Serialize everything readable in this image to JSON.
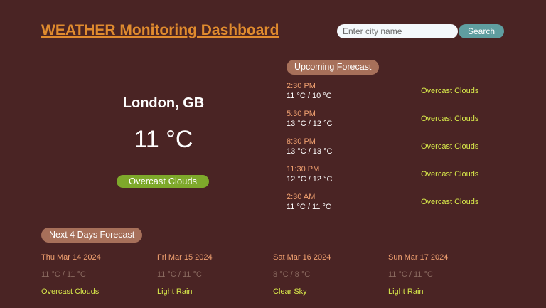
{
  "header": {
    "title": "WEATHER Monitoring Dashboard"
  },
  "search": {
    "placeholder": "Enter city name",
    "value": "",
    "button_label": "Search"
  },
  "current": {
    "location": "London, GB",
    "temperature": "11 °C",
    "condition": "Overcast Clouds"
  },
  "upcoming": {
    "heading": "Upcoming Forecast",
    "items": [
      {
        "time": "2:30 PM",
        "temp": "11 °C / 10 °C",
        "desc": "Overcast Clouds"
      },
      {
        "time": "5:30 PM",
        "temp": "13 °C / 12 °C",
        "desc": "Overcast Clouds"
      },
      {
        "time": "8:30 PM",
        "temp": "13 °C / 13 °C",
        "desc": "Overcast Clouds"
      },
      {
        "time": "11:30 PM",
        "temp": "12 °C / 12 °C",
        "desc": "Overcast Clouds"
      },
      {
        "time": "2:30 AM",
        "temp": "11 °C / 11 °C",
        "desc": "Overcast Clouds"
      }
    ]
  },
  "daily": {
    "heading": "Next 4 Days Forecast",
    "days": [
      {
        "date": "Thu Mar 14 2024",
        "temp": "11 °C / 11 °C",
        "desc": "Overcast Clouds"
      },
      {
        "date": "Fri Mar 15 2024",
        "temp": "11 °C / 11 °C",
        "desc": "Light Rain"
      },
      {
        "date": "Sat Mar 16 2024",
        "temp": "8 °C / 8 °C",
        "desc": "Clear Sky"
      },
      {
        "date": "Sun Mar 17 2024",
        "temp": "11 °C / 11 °C",
        "desc": "Light Rain"
      }
    ]
  },
  "colors": {
    "background": "#4a2424",
    "title": "#e08b2e",
    "pill": "#a7705a",
    "condition_badge": "#7ea92b",
    "time_text": "#f0a070",
    "desc_text": "#d7e84a",
    "search_button": "#5f9ea0"
  }
}
